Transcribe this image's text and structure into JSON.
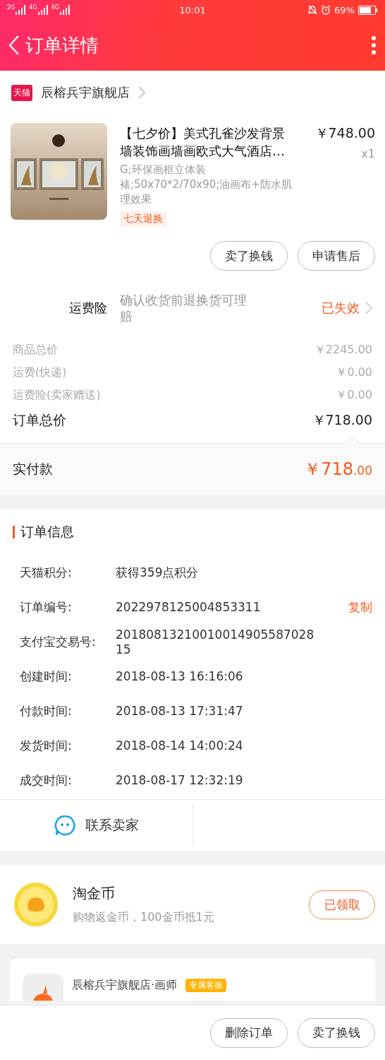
{
  "status_bar": {
    "networks": [
      "2G",
      "4G",
      "4G"
    ],
    "time": "10:01",
    "battery": "69%"
  },
  "header": {
    "title": "订单详情"
  },
  "store": {
    "badge": "天猫",
    "name": "辰榕兵宇旗舰店"
  },
  "product": {
    "title": "【七夕价】美式孔雀沙发背景墙装饰画墙画欧式大气酒店…",
    "price": "￥748.00",
    "quantity": "x1",
    "sku": "G;环保画框立体装裱;50x70*2/70x90;油画布+防水肌理效果",
    "tag": "七天退换"
  },
  "item_actions": [
    "卖了换钱",
    "申请售后"
  ],
  "insurance": {
    "label": "运费险",
    "description": "确认收货前退换货可理赔",
    "status": "已失效"
  },
  "price_rows": [
    {
      "kind": "minor",
      "label": "商品总价",
      "value": "￥2245.00"
    },
    {
      "kind": "minor",
      "label": "运费(快递)",
      "value": "￥0.00"
    },
    {
      "kind": "minor",
      "label": "运费险(卖家赠送)",
      "value": "￥0.00"
    },
    {
      "kind": "total",
      "label": "订单总价",
      "value": "￥718.00"
    }
  ],
  "paid": {
    "label": "实付款",
    "amount": "￥718",
    "decimals": ".00"
  },
  "order_info": {
    "title": "订单信息",
    "rows": [
      {
        "label": "天猫积分:",
        "value": "获得359点积分"
      },
      {
        "label": "订单编号:",
        "value": "2022978125004853311",
        "action": "复制"
      },
      {
        "label": "支付宝交易号:",
        "value": "2018081321001001490558702815"
      },
      {
        "label": "创建时间:",
        "value": "2018-08-13 16:16:06"
      },
      {
        "label": "付款时间:",
        "value": "2018-08-13 17:31:47"
      },
      {
        "label": "发货时间:",
        "value": "2018-08-14 14:00:24"
      },
      {
        "label": "成交时间:",
        "value": "2018-08-17 12:32:19"
      }
    ]
  },
  "contact": {
    "label": "联系卖家"
  },
  "coins": {
    "title": "淘金币",
    "subtitle": "购物返金币，100金币抵1元",
    "button": "已领取"
  },
  "shop_card": {
    "name": "辰榕兵宇旗舰店·画师",
    "badge": "专属客服"
  },
  "bottom_actions": [
    "删除订单",
    "卖了换钱"
  ]
}
